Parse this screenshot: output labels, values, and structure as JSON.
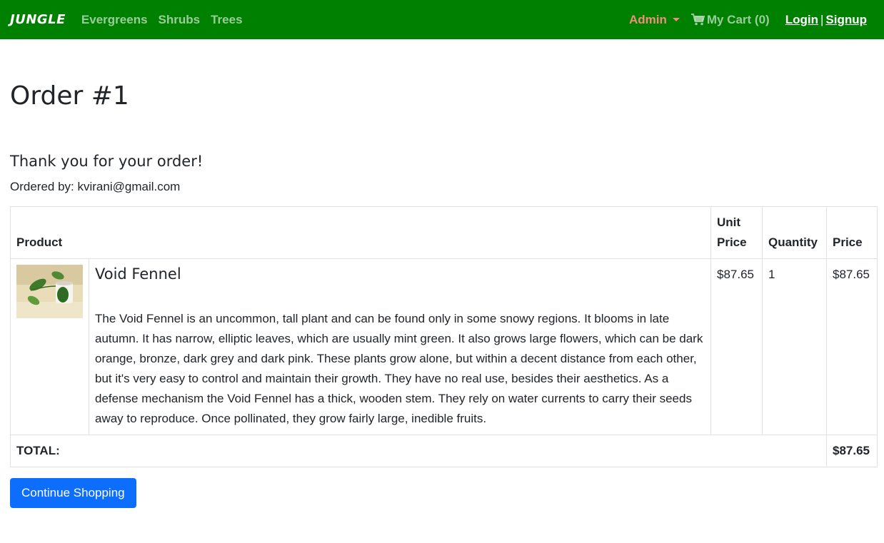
{
  "nav": {
    "brand": "JUNGLE",
    "links": [
      "Evergreens",
      "Shrubs",
      "Trees"
    ],
    "admin": "Admin",
    "cart": "My Cart (0)",
    "login": "Login",
    "separator": "|",
    "signup": "Signup"
  },
  "page": {
    "title": "Order #1",
    "thanks": "Thank you for your order!",
    "ordered_by": "Ordered by: kvirani@gmail.com"
  },
  "table": {
    "headers": {
      "product": "Product",
      "unit_price": "Unit Price",
      "quantity": "Quantity",
      "price": "Price"
    },
    "items": [
      {
        "name": "Void Fennel",
        "description": "The Void Fennel is an uncommon, tall plant and can be found only in some snowy regions. It blooms in late autumn. It has narrow, elliptic leaves, which are usually mint green. It also grows large flowers, which can be dark orange, bronze, dark grey and dark pink. These plants grow alone, but within a decent distance from each other, but it's very easy to control and maintain their growth. They have no real use, besides their aesthetics. As a defense mechanism the Void Fennel has a thick, wooden stem. They rely on water currents to carry their seeds away to reproduce. Once pollinated, they grow fairly large, inedible fruits.",
        "unit_price": "$87.65",
        "quantity": "1",
        "price": "$87.65"
      }
    ],
    "total_label": "TOTAL:",
    "total_value": "$87.65"
  },
  "actions": {
    "continue": "Continue Shopping"
  },
  "colors": {
    "navbar": "#008000",
    "admin": "#f08d7a",
    "button": "#0d6efd"
  },
  "icons": {
    "cart": "shopping-cart-icon",
    "caret": "caret-down-icon"
  }
}
